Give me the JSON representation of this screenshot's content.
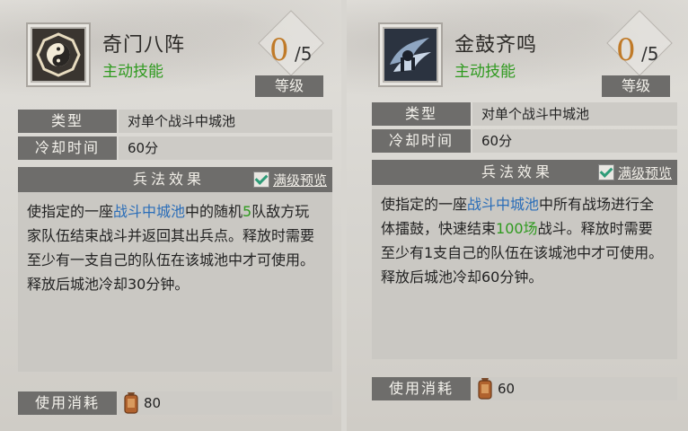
{
  "cards": [
    {
      "name": "奇门八阵",
      "type": "主动技能",
      "level_current": "0",
      "level_max": "/5",
      "level_label": "等级",
      "rows": [
        {
          "key": "类型",
          "value": "对单个战斗中城池"
        },
        {
          "key": "冷却时间",
          "value": "60分"
        }
      ],
      "effects_title": "兵法效果",
      "preview_label": "满级预览",
      "effect_parts": [
        "使指定的一座",
        "战斗中城池",
        "中的随机",
        "5",
        "队敌方玩家队伍结束战斗并返回其出兵点。释放时需要至少有一支自己的队伍在该城池中才可使用。释放后城池冷却30分钟。"
      ],
      "cost_label": "使用消耗",
      "cost_value": "80",
      "icon": "bagua-icon"
    },
    {
      "name": "金鼓齐鸣",
      "type": "主动技能",
      "level_current": "0",
      "level_max": "/5",
      "level_label": "等级",
      "rows": [
        {
          "key": "类型",
          "value": "对单个战斗中城池"
        },
        {
          "key": "冷却时间",
          "value": "60分"
        }
      ],
      "effects_title": "兵法效果",
      "preview_label": "满级预览",
      "effect_parts": [
        "使指定的一座",
        "战斗中城池",
        "中所有战场进行全体擂鼓，快速结束",
        "100场",
        "战斗。释放时需要至少有1支自己的队伍在该城池中才可使用。释放后城池冷却60分钟。"
      ],
      "cost_label": "使用消耗",
      "cost_value": "60",
      "icon": "war-drum-icon"
    }
  ],
  "colors": {
    "highlight_blue": "#2a6db8",
    "highlight_green": "#2f9a1f",
    "level_orange": "#c07a28"
  }
}
